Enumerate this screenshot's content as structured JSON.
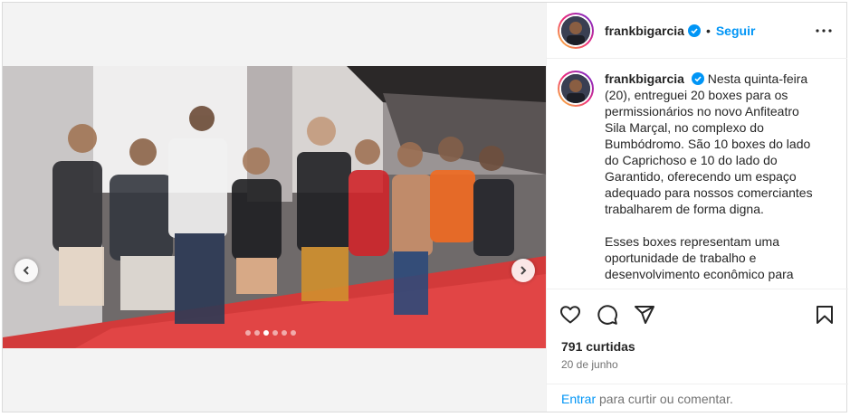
{
  "post": {
    "username": "frankbigarcia",
    "follow_label": "Seguir",
    "separator": "•",
    "caption_p1": "Nesta quinta-feira (20), entreguei 20 boxes para os permissionários no novo Anfiteatro Sila Marçal, no complexo do Bumbódromo. São 10 boxes do lado do Caprichoso e 10 do lado do Garantido, oferecendo um espaço adequado para nossos comerciantes trabalharem de forma digna.",
    "caption_p2": "Esses boxes representam uma oportunidade de trabalho e desenvolvimento econômico para",
    "likes": "791 curtidas",
    "date": "20 de junho",
    "login_link": "Entrar",
    "login_suffix": " para curtir ou comentar."
  },
  "carousel": {
    "slide_count": 6,
    "active_index": 2
  },
  "icons": {
    "verified": "verified-badge-icon",
    "more": "more-options-icon",
    "like": "heart-icon",
    "comment": "comment-icon",
    "share": "share-icon",
    "save": "bookmark-icon",
    "prev": "chevron-left-icon",
    "next": "chevron-right-icon"
  },
  "colors": {
    "accent": "#0095f6",
    "verified": "#0095f6",
    "text": "#262626",
    "muted": "#737373",
    "floor": "#d93a3a"
  }
}
